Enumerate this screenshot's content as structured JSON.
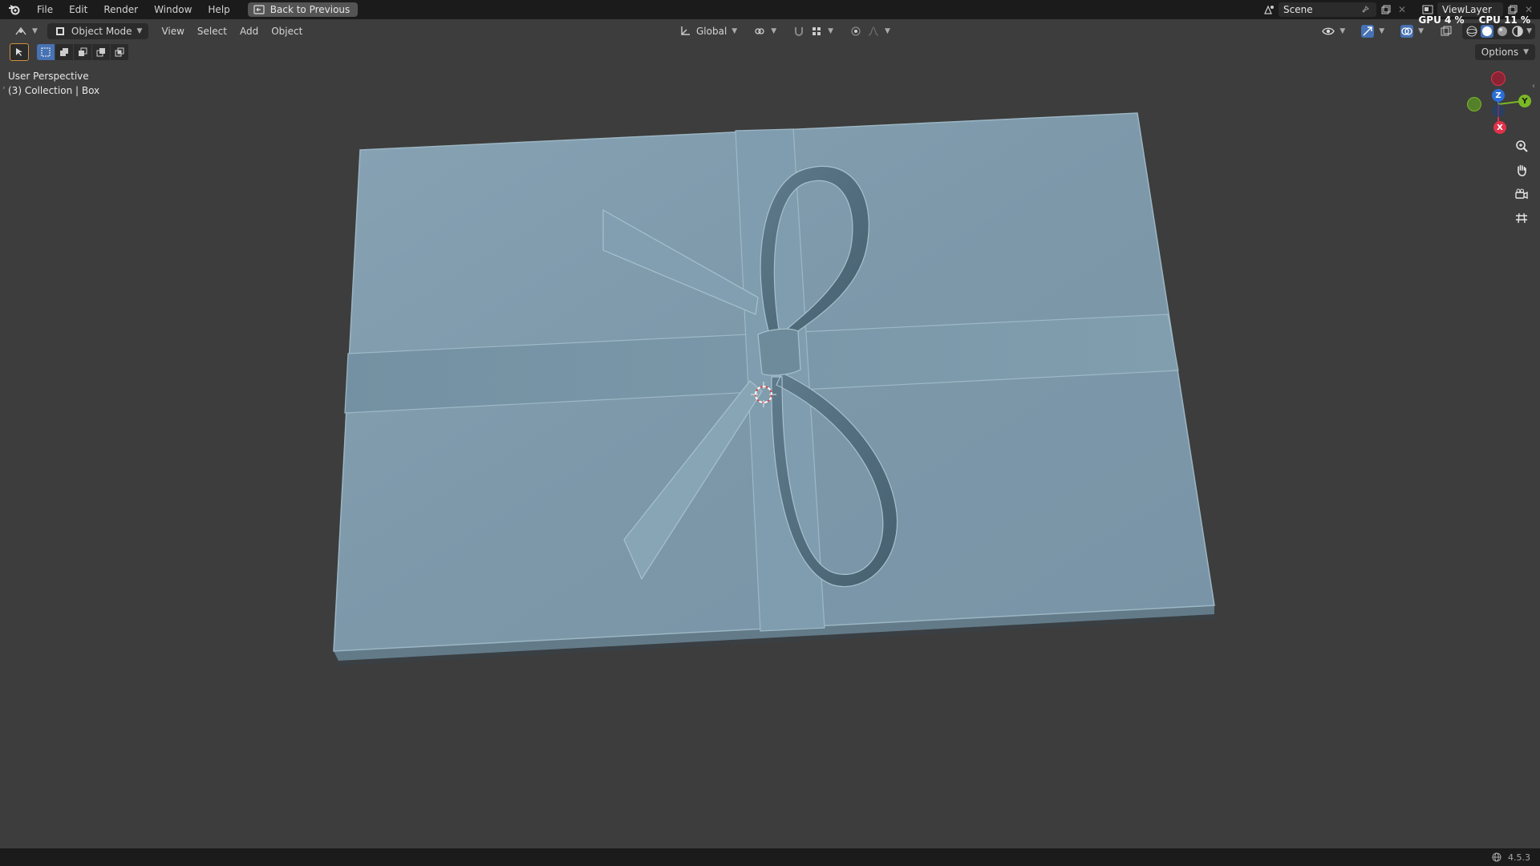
{
  "menubar": {
    "items": [
      "File",
      "Edit",
      "Render",
      "Window",
      "Help"
    ],
    "back_button": "Back to Previous",
    "scene_name": "Scene",
    "view_layer": "ViewLayer",
    "gpu_stat": "GPU 4 %",
    "cpu_stat": "CPU 11 %"
  },
  "header": {
    "mode": "Object Mode",
    "menus": [
      "View",
      "Select",
      "Add",
      "Object"
    ],
    "transform_orientation": "Global",
    "options_label": "Options"
  },
  "viewport": {
    "perspective": "User Perspective",
    "collection": "(3) Collection | Box"
  },
  "gizmo": {
    "axes": [
      "X",
      "Y",
      "Z"
    ],
    "colors": {
      "x": "#e0324a",
      "y": "#7ab824",
      "z": "#2a6ed8"
    }
  },
  "statusbar": {
    "version": "4.5.3"
  },
  "colors": {
    "background": "#3d3d3d",
    "object_fill": "#7f9cac",
    "menu_bg": "#1b1b1b",
    "active_blue": "#4772b3"
  },
  "icons": [
    "blender-logo-icon",
    "back-icon",
    "editor-type-icon",
    "object-mode-icon",
    "select-tool-icon",
    "global-orientation-icon",
    "pivot-icon",
    "snap-icon",
    "proportional-edit-icon",
    "visibility-icon",
    "gizmo-icon",
    "overlay-icon",
    "xray-icon",
    "shading-solid-icon",
    "zoom-icon",
    "pan-hand-icon",
    "camera-icon",
    "grid-icon",
    "3d-cursor-icon"
  ]
}
